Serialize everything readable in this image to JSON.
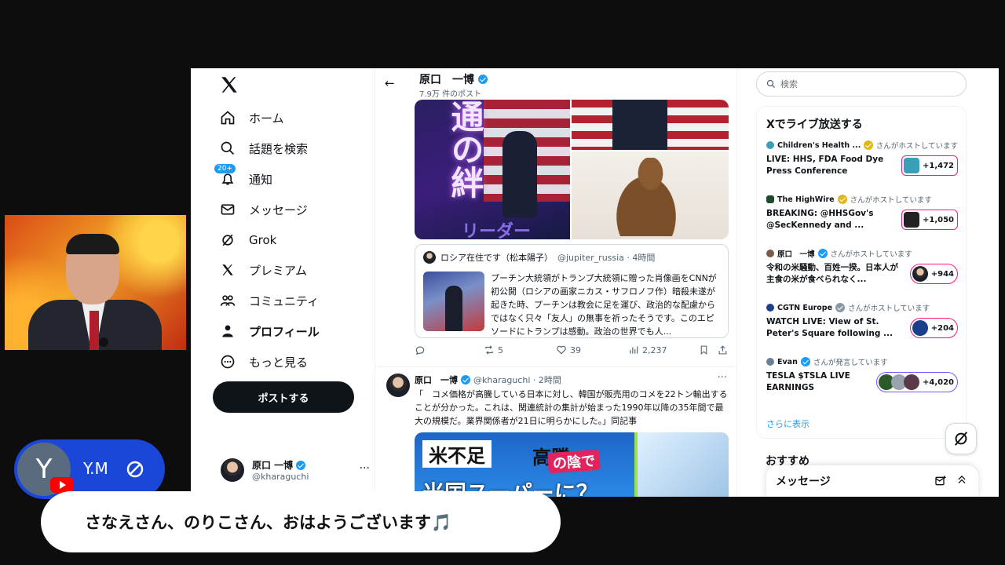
{
  "nav": {
    "items": [
      {
        "label": "ホーム",
        "icon": "home-icon"
      },
      {
        "label": "話題を検索",
        "icon": "search-icon"
      },
      {
        "label": "通知",
        "icon": "bell-icon",
        "badge": "20+"
      },
      {
        "label": "メッセージ",
        "icon": "mail-icon"
      },
      {
        "label": "Grok",
        "icon": "grok-icon"
      },
      {
        "label": "プレミアム",
        "icon": "x-icon"
      },
      {
        "label": "コミュニティ",
        "icon": "community-icon"
      },
      {
        "label": "プロフィール",
        "icon": "person-icon"
      },
      {
        "label": "もっと見る",
        "icon": "more-circle-icon"
      }
    ],
    "post_button": "ポストする",
    "account": {
      "name": "原口 一博",
      "handle": "@kharaguchi",
      "more": "···"
    }
  },
  "profile": {
    "back": "←",
    "name": "原口　一博",
    "post_count": "7.9万 件のポスト"
  },
  "tweet1": {
    "media_text": {
      "big": "通の絆",
      "banner": "リーダー"
    },
    "quote": {
      "author": "ロシア在住です（松本陽子）",
      "handle": "@jupiter_russia · 4時間",
      "text": "プーチン大統領がトランプ大統領に贈った肖像画をCNNが初公開（ロシアの画家ニカス・サフロノフ作）暗殺未遂が起きた時、プーチンは教会に足を運び、政治的な配慮からではなく只々「友人」の無事を祈ったそうです。このエピソードにトランプは感動。政治の世界でも人..."
    },
    "actions": {
      "reply": "",
      "repost": "5",
      "like": "39",
      "views": "2,237"
    }
  },
  "tweet2": {
    "author": "原口　一博",
    "handle": "@kharaguchi · 2時間",
    "more": "···",
    "text": "「　コメ価格が高騰している日本に対し、韓国が販売用のコメを22トン輸出することが分かった。これは、関連統計の集計が始まった1990年以降の35年間で最大の規模だ。業界関係者が21日に明らかにした。」同記事",
    "image_text": {
      "line1": "米不足",
      "line2": "高騰",
      "line3": "の陰で",
      "line4": "米国スーパーに？"
    }
  },
  "right": {
    "search_placeholder": "検索",
    "live_title": "Xでライブ放送する",
    "live_items": [
      {
        "host": "Children's Health ...",
        "host_suffix": "さんがホストしています",
        "badge": "gold",
        "title": "LIVE: HHS, FDA Food Dye Press Conference",
        "count": "+1,472"
      },
      {
        "host": "The HighWire",
        "host_suffix": "さんがホストしています",
        "badge": "gold",
        "title": "BREAKING: @HHSGov's @SecKennedy  and ...",
        "count": "+1,050"
      },
      {
        "host": "原口　一博",
        "host_suffix": "さんがホストしています",
        "badge": "blue",
        "title": "令和の米騒動、百姓一揆。日本人が主食の米が食べられなく...",
        "count": "+944"
      },
      {
        "host": "CGTN Europe",
        "host_suffix": "さんがホストしています",
        "badge": "grey",
        "title": "WATCH LIVE: View of St. Peter's Square following ...",
        "count": "+204"
      },
      {
        "host": "Evan",
        "host_suffix": "さんが発言しています",
        "badge": "blue",
        "title": "TESLA $TSLA LIVE EARNINGS",
        "count": "+4,020"
      }
    ],
    "show_more": "さらに表示",
    "reco_title": "おすすめ",
    "message_dock": "メッセージ"
  },
  "overlay": {
    "user_initial": "Y",
    "user_name": "Y.M",
    "caption": "さなえさん、のりこさん、おはようございます🎵"
  },
  "colors": {
    "x_blue": "#1d9bf0",
    "live_pink": "#f91880",
    "chip_blue": "#1a47d8"
  }
}
